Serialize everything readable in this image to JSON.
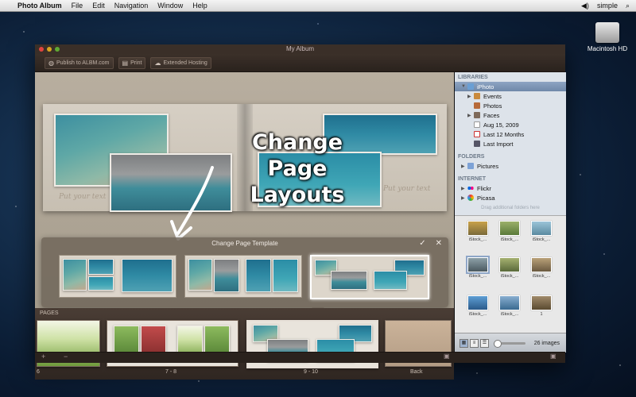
{
  "menubar": {
    "app_name": "Photo Album",
    "items": [
      "File",
      "Edit",
      "Navigation",
      "Window",
      "Help"
    ],
    "user": "simple"
  },
  "desktop": {
    "disk_label": "Macintosh HD"
  },
  "window": {
    "title": "My Album"
  },
  "toolbar": {
    "publish_label": "Publish to ALBM.com",
    "print_label": "Print",
    "hosting_label": "Extended Hosting"
  },
  "spread": {
    "placeholder_left": "Put your text",
    "placeholder_right": "Put your text"
  },
  "overlay": {
    "line1": "Change",
    "line2": "Page",
    "line3": "Layouts"
  },
  "template_popover": {
    "title": "Change Page Template",
    "confirm_icon": "checkmark-icon",
    "close_icon": "close-icon"
  },
  "pages": {
    "label": "PAGES",
    "numbers": [
      "6",
      "7 - 8",
      "9 - 10",
      "Back"
    ]
  },
  "sidebar": {
    "libraries_label": "LIBRARIES",
    "libraries": [
      {
        "label": "iPhoto",
        "selected": true
      },
      {
        "label": "Events"
      },
      {
        "label": "Photos"
      },
      {
        "label": "Faces"
      },
      {
        "label": "Aug 15, 2009"
      },
      {
        "label": "Last 12 Months"
      },
      {
        "label": "Last Import"
      }
    ],
    "folders_label": "FOLDERS",
    "folders": [
      {
        "label": "Pictures"
      }
    ],
    "internet_label": "INTERNET",
    "internet": [
      {
        "label": "Flickr"
      },
      {
        "label": "Picasa"
      }
    ],
    "drop_hint": "Drag additional folders here"
  },
  "browser": {
    "cells": [
      "iStock_...",
      "iStock_...",
      "iStock_...",
      "iStock_...",
      "iStock_...",
      "iStock_...",
      "iStock_...",
      "iStock_...",
      "1"
    ],
    "count_label": "26 images"
  },
  "colors": {
    "accent": "#6f88a9",
    "window_bg": "#2e2520",
    "sidebar_bg": "#dde3ea"
  }
}
